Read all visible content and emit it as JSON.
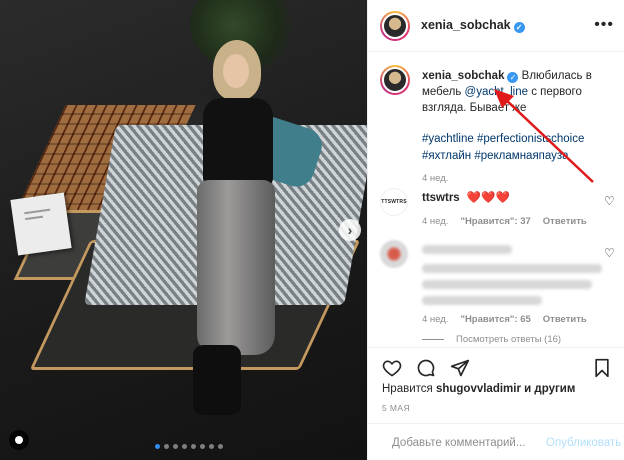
{
  "post": {
    "username": "xenia_sobchak",
    "verified": true,
    "more_icon": "•••",
    "caption_prefix": "Влюбилась в мебель ",
    "caption_mention": "@yacht_line",
    "caption_suffix": " с первого взгляда. Бывает же",
    "hashtags": "#yachtline #perfectionistschoice #яхтлайн #рекламнаяпауза",
    "caption_age": "4 нед."
  },
  "comments": [
    {
      "username": "ttswtrs",
      "text": "❤️❤️❤️",
      "age": "4 нед.",
      "likes": "\"Нравится\": 37",
      "reply": "Ответить",
      "avatar_text": "TTSWTRS"
    },
    {
      "username": "",
      "text": "",
      "age": "4 нед.",
      "likes": "\"Нравится\": 65",
      "reply": "Ответить"
    }
  ],
  "view_replies": "Посмотреть ответы (16)",
  "likes_line": {
    "prefix": "Нравится ",
    "user": "shugovvladimir",
    "suffix": " и другим"
  },
  "date": "5 МАЯ",
  "add_comment": {
    "placeholder": "Добавьте комментарий...",
    "publish": "Опубликовать"
  },
  "carousel": {
    "count": 8,
    "active": 0
  },
  "colors": {
    "link": "#00376b",
    "verified": "#3897f0",
    "arrow": "#e01a1a",
    "dot_active": "#2f8ef0"
  },
  "icons": [
    "heart-icon",
    "comment-icon",
    "share-icon",
    "bookmark-icon",
    "emoji-icon",
    "next-icon",
    "tag-icon",
    "more-icon"
  ]
}
